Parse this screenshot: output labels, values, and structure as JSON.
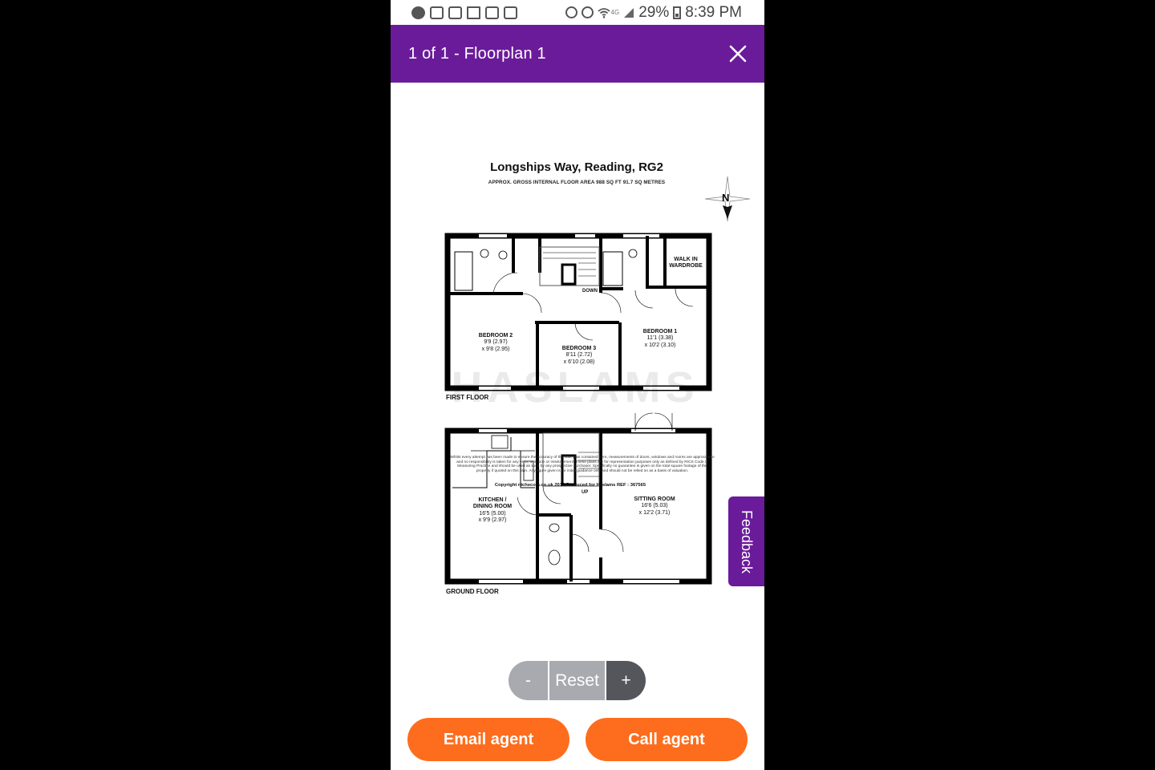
{
  "status_bar": {
    "battery": "29%",
    "time": "8:39 PM",
    "network": "4G"
  },
  "viewer": {
    "title": "1 of 1 - Floorplan 1"
  },
  "floorplan": {
    "title": "Longships Way, Reading, RG2",
    "subtitle": "APPROX. GROSS INTERNAL FLOOR AREA 988 SQ FT 91.7 SQ METRES",
    "compass_label": "N",
    "watermark": "HASLAMS",
    "first_floor_label": "FIRST FLOOR",
    "ground_floor_label": "GROUND FLOOR",
    "down_label": "DOWN",
    "up_label": "UP",
    "rooms": {
      "walk_in": {
        "name": "WALK IN",
        "name2": "WARDROBE"
      },
      "bedroom2": {
        "name": "BEDROOM 2",
        "dim1": "9'9 (2.97)",
        "dim2": "x 9'8 (2.95)"
      },
      "bedroom3": {
        "name": "BEDROOM 3",
        "dim1": "8'11 (2.72)",
        "dim2": "x 6'10 (2.08)"
      },
      "bedroom1": {
        "name": "BEDROOM 1",
        "dim1": "11'1 (3.38)",
        "dim2": "x 10'2 (3.10)"
      },
      "kitchen": {
        "name": "KITCHEN /",
        "name2": "DINING ROOM",
        "dim1": "16'5 (5.00)",
        "dim2": "x 9'9 (2.97)"
      },
      "sitting": {
        "name": "SITTING ROOM",
        "dim1": "16'6 (5.03)",
        "dim2": "x 12'2 (3.71)"
      }
    },
    "disclaimer": "Whilst every attempt has been made to ensure the accuracy of the floor plan contained here, measurements of doors, windows and rooms are approximate and no responsibility is taken for any error, omission or misstatement. These plans are for representation purposes only as defined by RICS Code of Measuring Practice and should be used as such by any prospective purchaser. Specifically no guarantee is given on the total square footage of the property if quoted on this plan. Any figure given is for initial guidance only and should not be relied on as a basis of valuation.",
    "copyright": "Copyright nichecom.co.uk 2018   Produced for Haslams   REF : 367565"
  },
  "zoom": {
    "minus": "-",
    "reset": "Reset",
    "plus": "+"
  },
  "actions": {
    "email": "Email agent",
    "call": "Call agent"
  },
  "feedback": "Feedback"
}
